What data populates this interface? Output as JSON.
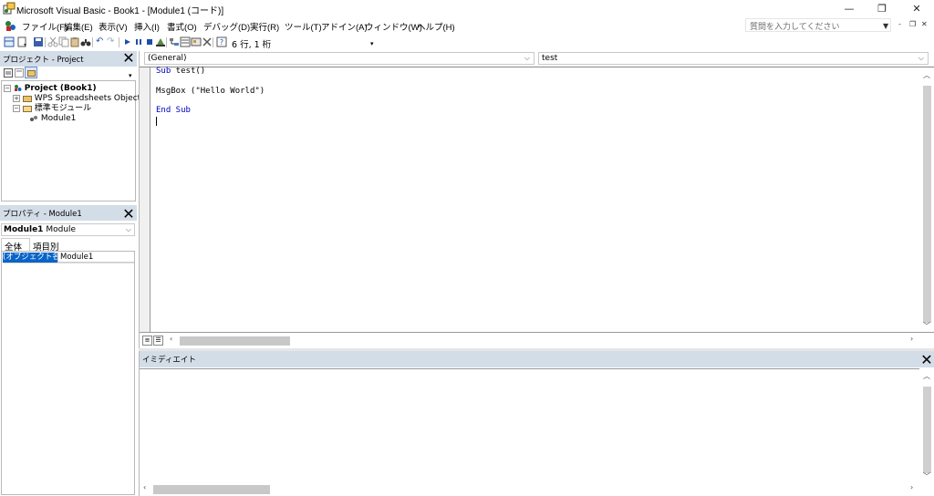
{
  "window": {
    "title": "Microsoft Visual Basic - Book1 - [Module1 (コード)]",
    "minimize": "—",
    "restore": "❐",
    "close": "✕"
  },
  "menu": [
    "ファイル(F)",
    "編集(E)",
    "表示(V)",
    "挿入(I)",
    "書式(O)",
    "デバッグ(D)",
    "実行(R)",
    "ツール(T)",
    "アドイン(A)",
    "ウィンドウ(W)",
    "ヘルプ(H)"
  ],
  "help_search": {
    "placeholder": "質問を入力してください"
  },
  "toolbar": {
    "position": "6 行, 1 桁"
  },
  "project_pane": {
    "title": "プロジェクト - Project",
    "tree": {
      "root": "Project (Book1)",
      "folder1": "WPS Spreadsheets Objects",
      "folder2": "標準モジュール",
      "module": "Module1"
    }
  },
  "properties_pane": {
    "title": "プロパティ - Module1",
    "object_select": {
      "name": "Module1",
      "type": "Module"
    },
    "tabs": [
      "全体",
      "項目別"
    ],
    "row": {
      "name": "(オブジェクト名)",
      "value": "Module1"
    }
  },
  "code": {
    "object_dropdown": "(General)",
    "procedure_dropdown": "test",
    "lines": [
      {
        "kw": "Sub",
        "rest": " test()"
      },
      {
        "kw": "",
        "rest": "MsgBox (\"Hello World\")"
      },
      {
        "kw": "End Sub",
        "rest": ""
      }
    ]
  },
  "immediate": {
    "title": "イミディエイト"
  },
  "colors": {
    "pane_title_bg": "#d3dde8",
    "keyword": "#0000c0",
    "selection": "#0a64c8"
  }
}
